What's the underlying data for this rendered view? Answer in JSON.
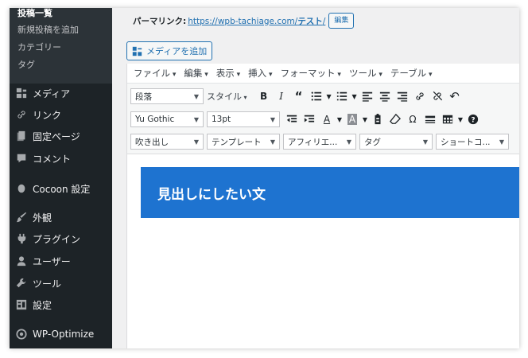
{
  "sidebar": {
    "submenu": [
      {
        "label": "投稿一覧",
        "current": true
      },
      {
        "label": "新規投稿を追加"
      },
      {
        "label": "カテゴリー"
      },
      {
        "label": "タグ"
      }
    ],
    "menu": [
      {
        "label": "メディア",
        "icon": "media-icon"
      },
      {
        "label": "リンク",
        "icon": "link-icon"
      },
      {
        "label": "固定ページ",
        "icon": "page-icon"
      },
      {
        "label": "コメント",
        "icon": "comment-icon"
      },
      {
        "label": "Cocoon 設定",
        "icon": "cocoon-icon"
      },
      {
        "label": "外観",
        "icon": "appearance-icon"
      },
      {
        "label": "プラグイン",
        "icon": "plugin-icon"
      },
      {
        "label": "ユーザー",
        "icon": "user-icon"
      },
      {
        "label": "ツール",
        "icon": "tools-icon"
      },
      {
        "label": "設定",
        "icon": "settings-icon"
      },
      {
        "label": "WP-Optimize",
        "icon": "wp-optimize-icon"
      }
    ]
  },
  "permalink": {
    "label": "パーマリンク:",
    "url_base": "https://wpb-tachiage.com/",
    "url_slug": "テスト",
    "url_tail": "/",
    "edit_label": "編集"
  },
  "media_button": {
    "label": "メディアを追加"
  },
  "menubar": [
    "ファイル",
    "編集",
    "表示",
    "挿入",
    "フォーマット",
    "ツール",
    "テーブル"
  ],
  "toolbar": {
    "row1": {
      "format_select": "段落",
      "style_label": "スタイル"
    },
    "row2": {
      "font_select": "Yu Gothic",
      "size_select": "13pt",
      "text_color": "A",
      "bg_color": "A",
      "omega": "Ω"
    },
    "row3": {
      "balloon_select": "吹き出し",
      "template_select": "テンプレート",
      "affiliate_select": "アフィリエ...",
      "tag_select": "タグ",
      "shortcode_select": "ショートコ..."
    }
  },
  "content": {
    "heading": "見出しにしたい文"
  },
  "colors": {
    "accent": "#2271b1",
    "heading_bg": "#1e73d0",
    "sidebar_bg": "#1d2327"
  }
}
